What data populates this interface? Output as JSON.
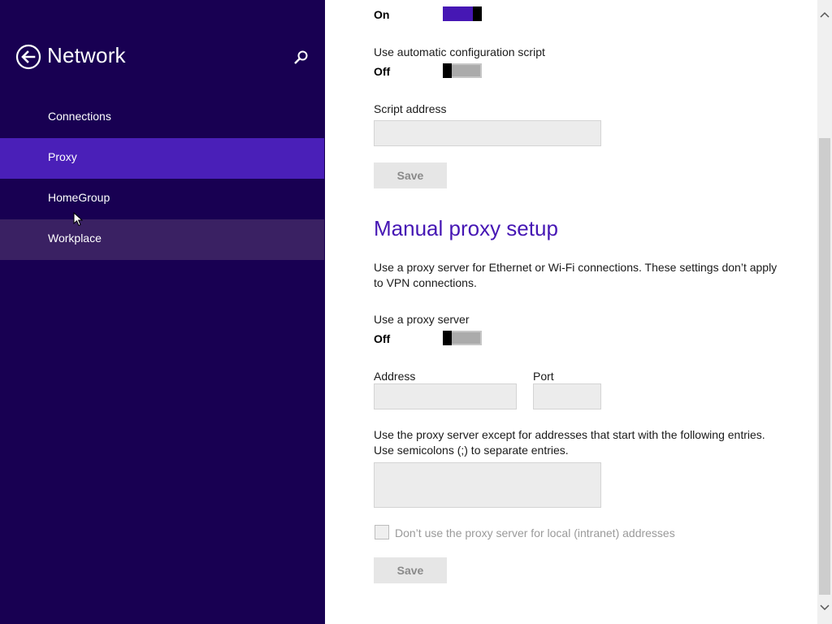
{
  "sidebar": {
    "title": "Network",
    "back_icon": "back-arrow-circle-icon",
    "search_icon": "search-icon",
    "items": [
      {
        "label": "Connections",
        "state": "normal"
      },
      {
        "label": "Proxy",
        "state": "selected"
      },
      {
        "label": "HomeGroup",
        "state": "normal"
      },
      {
        "label": "Workplace",
        "state": "hover"
      }
    ]
  },
  "auto_setup": {
    "detect_settings": {
      "state": "On"
    },
    "config_script": {
      "label": "Use automatic configuration script",
      "state": "Off"
    },
    "script_address": {
      "label": "Script address",
      "value": ""
    },
    "save_label": "Save"
  },
  "manual_setup": {
    "heading": "Manual proxy setup",
    "description_line1": "Use a proxy server for Ethernet or Wi-Fi connections. These settings don’t apply",
    "description_line2": "to VPN connections.",
    "use_proxy": {
      "label": "Use a proxy server",
      "state": "Off"
    },
    "address": {
      "label": "Address",
      "value": ""
    },
    "port": {
      "label": "Port",
      "value": ""
    },
    "exceptions_line1": "Use the proxy server except for addresses that start with the following entries.",
    "exceptions_line2": "Use semicolons (;) to separate entries.",
    "exceptions_value": "",
    "local_bypass": {
      "label": "Don’t use the proxy server for local (intranet) addresses",
      "checked": false
    },
    "save_label": "Save"
  },
  "colors": {
    "sidebar_bg": "#180052",
    "selected_bg": "#4a1fb8",
    "accent": "#4617b4"
  }
}
